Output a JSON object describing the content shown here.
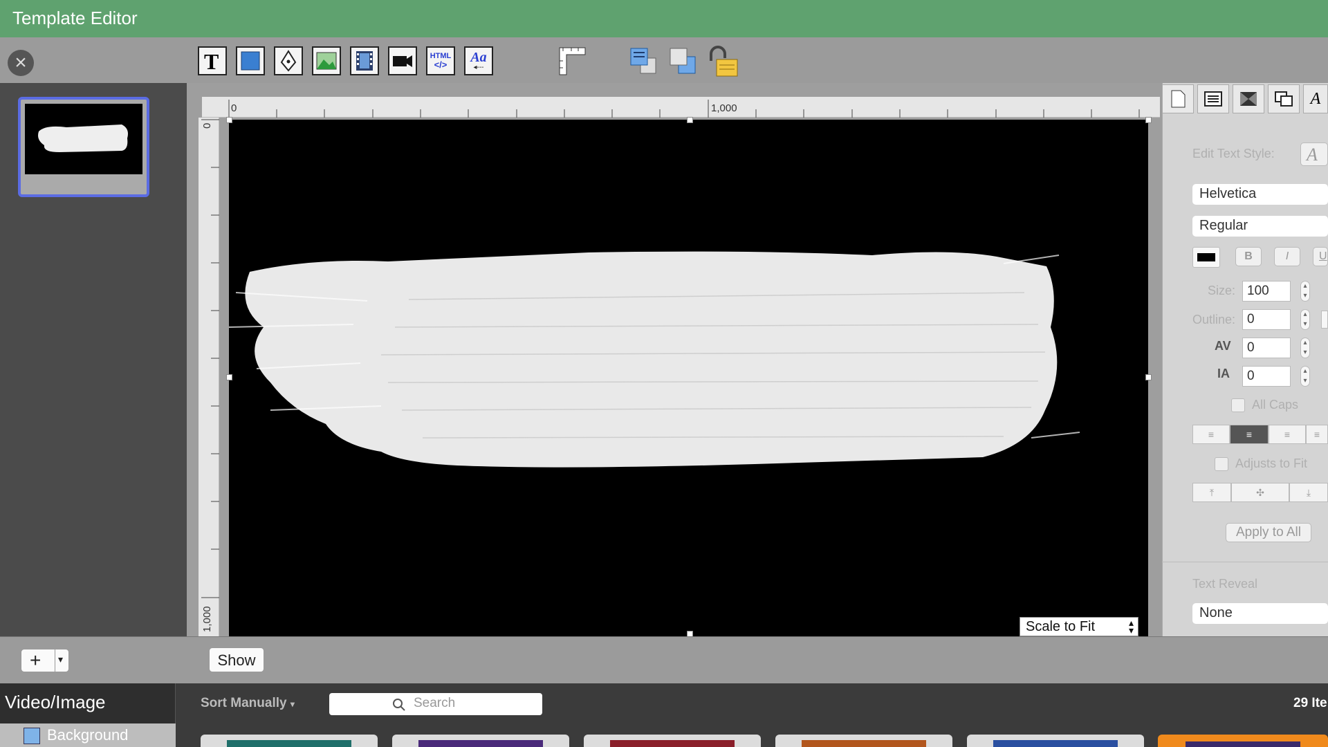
{
  "window": {
    "title": "Template Editor"
  },
  "toolbar": {
    "close_icon": "close-icon",
    "tools": [
      "text-tool-icon",
      "shape-tool-icon",
      "pen-tool-icon",
      "image-tool-icon",
      "film-tool-icon",
      "video-camera-tool-icon",
      "html-tool-icon",
      "text-style-tool-icon"
    ],
    "html_label": "HTML",
    "aa_label": "Aa"
  },
  "rulers": {
    "top_labels": [
      "0",
      "1,000"
    ],
    "left_labels": [
      "0",
      "1,000"
    ]
  },
  "canvas": {
    "scale_select": "Scale to Fit"
  },
  "inspector": {
    "edit_text_style_label": "Edit Text Style:",
    "font": "Helvetica",
    "style": "Regular",
    "bold": "B",
    "italic": "I",
    "underline": "U",
    "size_label": "Size:",
    "size_value": "100",
    "outline_label": "Outline:",
    "outline_value": "0",
    "kerning_label": "AV",
    "kerning_value": "0",
    "leading_label": "IA",
    "leading_value": "0",
    "all_caps_label": "All Caps",
    "adjusts_to_fit_label": "Adjusts to Fit",
    "apply_all_label": "Apply to All",
    "text_reveal_label": "Text Reveal",
    "text_reveal_value": "None"
  },
  "bottom": {
    "add_label": "+",
    "show_label": "Show"
  },
  "library": {
    "section": "Video/Image",
    "item": "Background",
    "sort": "Sort Manually",
    "search_placeholder": "Search",
    "count": "29 Ite"
  },
  "colors": {
    "titlebar": "#5fa26f",
    "selection": "#5b6ce3",
    "accent_orange": "#f08a1c"
  }
}
